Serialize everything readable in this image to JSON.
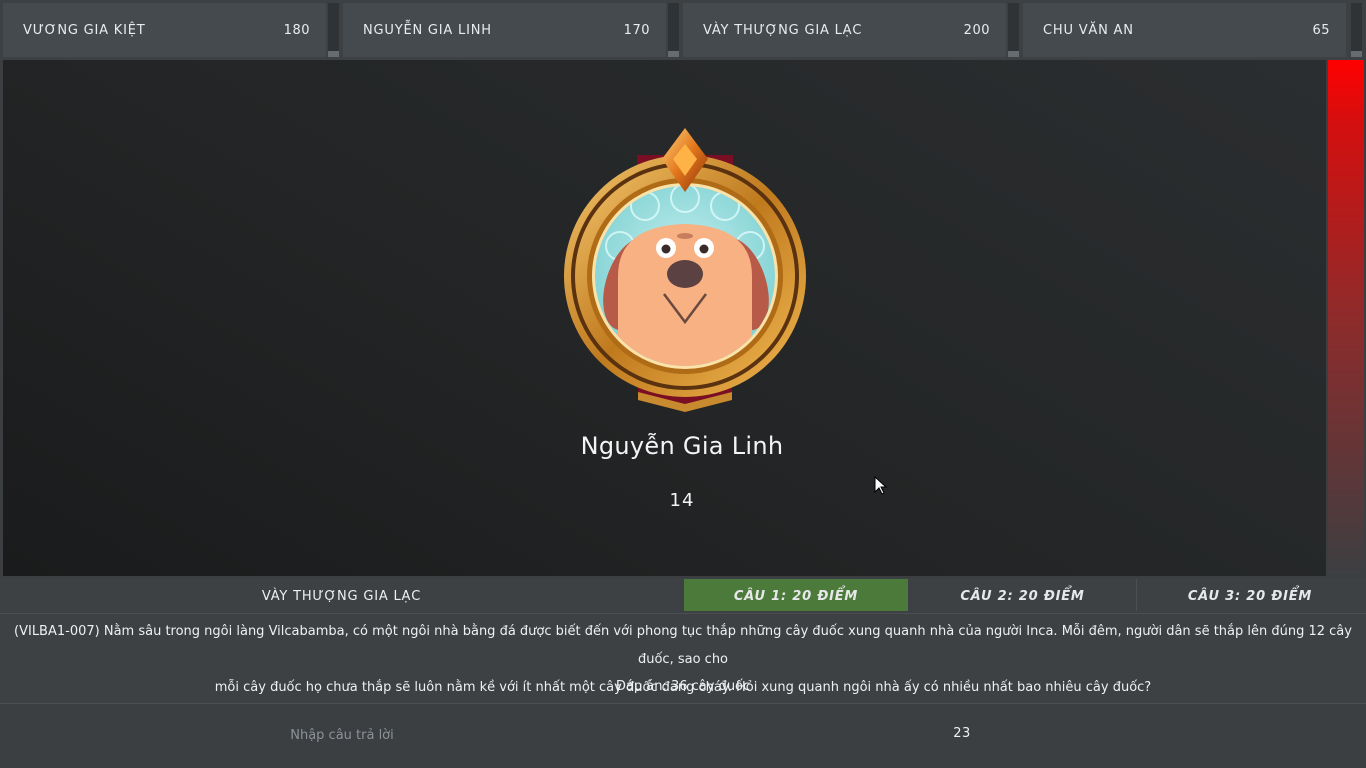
{
  "players": [
    {
      "name": "VƯƠNG GIA KIỆT",
      "score": "180"
    },
    {
      "name": "NGUYỄN GIA LINH",
      "score": "170"
    },
    {
      "name": "VÀY THƯỢNG GIA LẠC",
      "score": "200"
    },
    {
      "name": "CHU VĂN AN",
      "score": "65"
    }
  ],
  "stage": {
    "player_name": "Nguyễn Gia Linh",
    "player_score": "14",
    "avatar": "dog-avatar-icon"
  },
  "timer": {
    "remaining_fraction": 1.0,
    "color": "#ff0000"
  },
  "bottom": {
    "team_label": "VÀY THƯỢNG GIA LẠC",
    "tabs": [
      {
        "label": "CÂU 1: 20 ĐIỂM",
        "active": true
      },
      {
        "label": "CÂU 2: 20 ĐIỂM",
        "active": false
      },
      {
        "label": "CÂU 3: 20 ĐIỂM",
        "active": false
      }
    ],
    "question_line1": "(VILBA1-007) Nằm sâu trong ngôi làng Vilcabamba, có một ngôi nhà bằng đá được biết đến với phong tục thắp những cây đuốc xung quanh nhà của người Inca. Mỗi đêm, người dân sẽ thắp lên đúng 12 cây đuốc, sao cho",
    "question_line2": "mỗi cây đuốc họ chưa thắp sẽ luôn nằm kề với ít nhất một cây đuốc đang cháy. Hỏi xung quanh ngôi nhà ấy có nhiều nhất bao nhiêu cây đuốc?",
    "answer": "Đáp án: 36 cây đuốc",
    "input_placeholder": "Nhập câu trả lời",
    "input_value": "",
    "countdown": "23"
  },
  "colors": {
    "active_tab": "#4c7a3b",
    "panel": "#3d4144",
    "card": "#454a4e"
  }
}
